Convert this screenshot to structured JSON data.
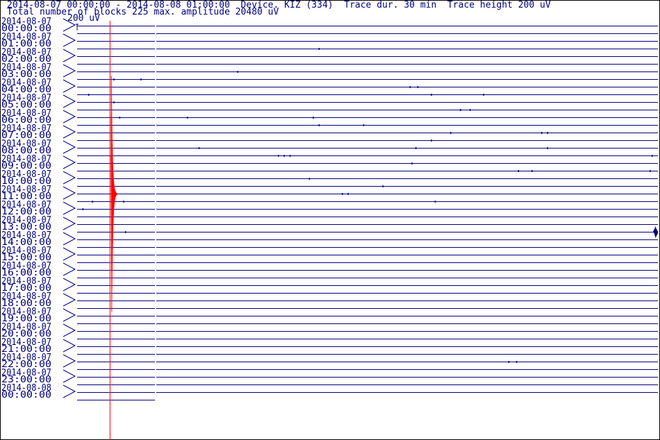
{
  "header": {
    "line1": "2014-08-07 00:00:00 - 2014-08-08 01:00:00  Device. KIZ (334)  Trace dur. 30 min  Trace height 200 uV",
    "line2": "Total number of blocks 225 max. amplitude 20480 uV"
  },
  "scale": {
    "label": "200 uV"
  },
  "colors": {
    "trace": "#000080",
    "event": "#ff0000",
    "marker": "#ff0000"
  },
  "chart_data": {
    "type": "line",
    "title": "",
    "trace_duration_min": 30,
    "trace_height_uV": 200,
    "max_amplitude_uV": 20480,
    "num_traces": 50,
    "hour_labels": [
      {
        "date": "2014-08-07",
        "time": "00:00:00"
      },
      {
        "date": "2014-08-07",
        "time": "01:00:00"
      },
      {
        "date": "2014-08-07",
        "time": "02:00:00"
      },
      {
        "date": "2014-08-07",
        "time": "03:00:00"
      },
      {
        "date": "2014-08-07",
        "time": "04:00:00"
      },
      {
        "date": "2014-08-07",
        "time": "05:00:00"
      },
      {
        "date": "2014-08-07",
        "time": "06:00:00"
      },
      {
        "date": "2014-08-07",
        "time": "07:00:00"
      },
      {
        "date": "2014-08-07",
        "time": "08:00:00"
      },
      {
        "date": "2014-08-07",
        "time": "09:00:00"
      },
      {
        "date": "2014-08-07",
        "time": "10:00:00"
      },
      {
        "date": "2014-08-07",
        "time": "11:00:00"
      },
      {
        "date": "2014-08-07",
        "time": "12:00:00"
      },
      {
        "date": "2014-08-07",
        "time": "13:00:00"
      },
      {
        "date": "2014-08-07",
        "time": "14:00:00"
      },
      {
        "date": "2014-08-07",
        "time": "15:00:00"
      },
      {
        "date": "2014-08-07",
        "time": "16:00:00"
      },
      {
        "date": "2014-08-07",
        "time": "17:00:00"
      },
      {
        "date": "2014-08-07",
        "time": "18:00:00"
      },
      {
        "date": "2014-08-07",
        "time": "19:00:00"
      },
      {
        "date": "2014-08-07",
        "time": "20:00:00"
      },
      {
        "date": "2014-08-07",
        "time": "21:00:00"
      },
      {
        "date": "2014-08-07",
        "time": "22:00:00"
      },
      {
        "date": "2014-08-07",
        "time": "23:00:00"
      },
      {
        "date": "2014-08-08",
        "time": "00:00:00"
      }
    ],
    "marker_time_min": 1.7,
    "event": {
      "trace_index": 22,
      "onset_min": 1.75,
      "decay_to_min": 2.1
    },
    "spikes": [
      {
        "trace": 3,
        "t": 12.5
      },
      {
        "trace": 6,
        "t": 8.3
      },
      {
        "trace": 7,
        "t": 1.9
      },
      {
        "trace": 7,
        "t": 3.3
      },
      {
        "trace": 8,
        "t": 17.2
      },
      {
        "trace": 8,
        "t": 17.6
      },
      {
        "trace": 9,
        "t": 0.6
      },
      {
        "trace": 9,
        "t": 18.3
      },
      {
        "trace": 9,
        "t": 21.0
      },
      {
        "trace": 10,
        "t": 1.9
      },
      {
        "trace": 11,
        "t": 19.8
      },
      {
        "trace": 11,
        "t": 20.3
      },
      {
        "trace": 12,
        "t": 2.2
      },
      {
        "trace": 12,
        "t": 5.7
      },
      {
        "trace": 12,
        "t": 12.2
      },
      {
        "trace": 13,
        "t": 12.5
      },
      {
        "trace": 13,
        "t": 14.8
      },
      {
        "trace": 14,
        "t": 19.3
      },
      {
        "trace": 14,
        "t": 24.0
      },
      {
        "trace": 14,
        "t": 24.3
      },
      {
        "trace": 15,
        "t": 18.3
      },
      {
        "trace": 16,
        "t": 6.3
      },
      {
        "trace": 16,
        "t": 17.5
      },
      {
        "trace": 16,
        "t": 24.3
      },
      {
        "trace": 17,
        "t": 10.4
      },
      {
        "trace": 17,
        "t": 10.7
      },
      {
        "trace": 17,
        "t": 11.0
      },
      {
        "trace": 17,
        "t": 29.7
      },
      {
        "trace": 18,
        "t": 17.3
      },
      {
        "trace": 19,
        "t": 22.8
      },
      {
        "trace": 19,
        "t": 23.5
      },
      {
        "trace": 19,
        "t": 29.6
      },
      {
        "trace": 20,
        "t": 12.0
      },
      {
        "trace": 21,
        "t": 15.8
      },
      {
        "trace": 22,
        "t": 13.7
      },
      {
        "trace": 22,
        "t": 14.0
      },
      {
        "trace": 23,
        "t": 0.8
      },
      {
        "trace": 23,
        "t": 2.4
      },
      {
        "trace": 23,
        "t": 18.5
      },
      {
        "trace": 24,
        "t": 0.3
      },
      {
        "trace": 27,
        "t": 2.5
      },
      {
        "trace": 27,
        "t": 29.9
      },
      {
        "trace": 44,
        "t": 22.3
      },
      {
        "trace": 44,
        "t": 22.7
      }
    ]
  }
}
